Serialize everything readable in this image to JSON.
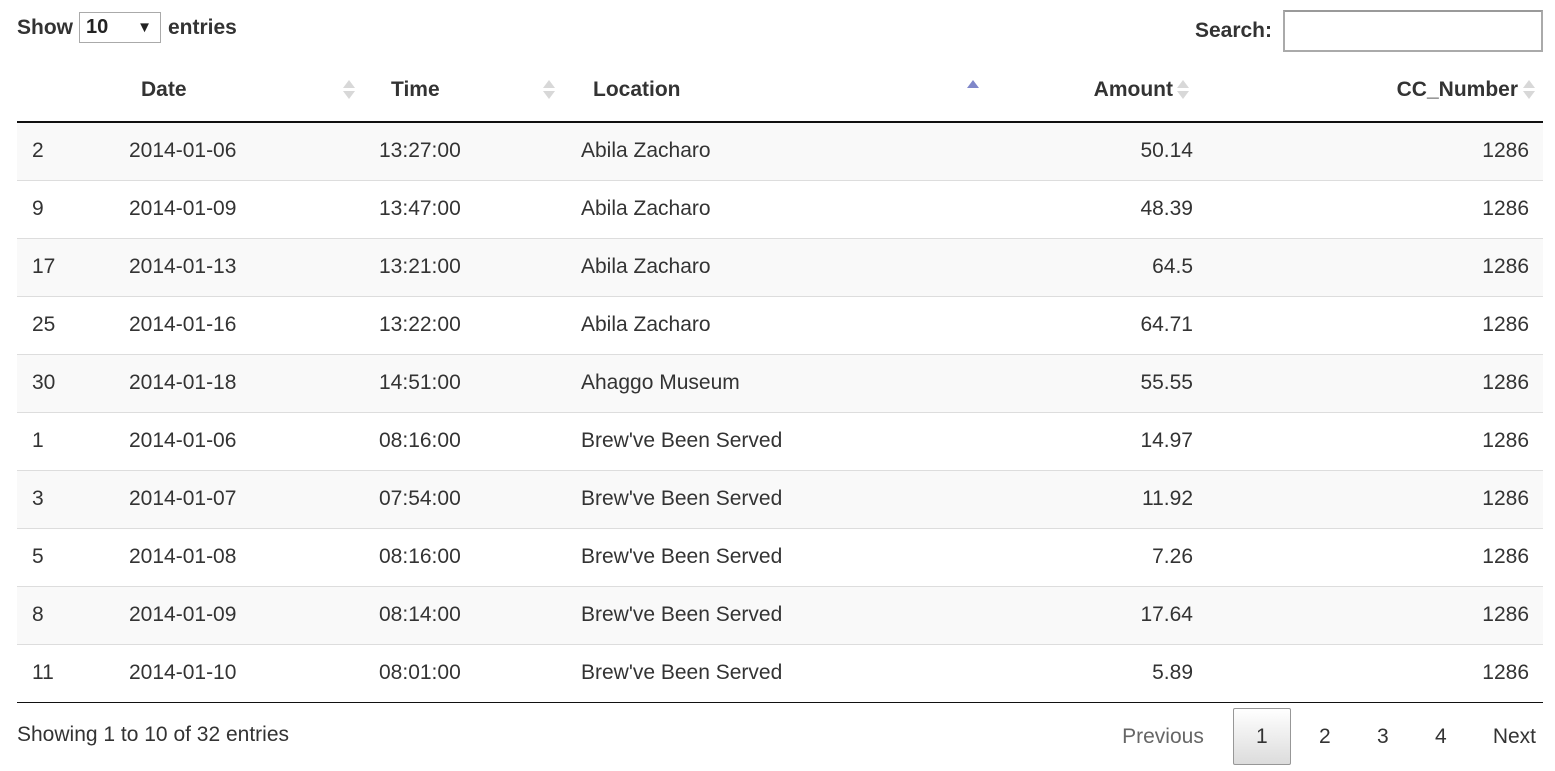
{
  "length_control": {
    "show_label": "Show",
    "selected": "10",
    "entries_label": "entries",
    "caret": "▼"
  },
  "search": {
    "label": "Search:",
    "value": "",
    "placeholder": ""
  },
  "table": {
    "columns": [
      {
        "key": "row",
        "label": ""
      },
      {
        "key": "date",
        "label": "Date"
      },
      {
        "key": "time",
        "label": "Time"
      },
      {
        "key": "location",
        "label": "Location"
      },
      {
        "key": "amount",
        "label": "Amount"
      },
      {
        "key": "cc_number",
        "label": "CC_Number"
      }
    ],
    "sorted_column": "location",
    "sort_direction": "ascending",
    "rows": [
      {
        "row": "2",
        "date": "2014-01-06",
        "time": "13:27:00",
        "location": "Abila Zacharo",
        "amount": "50.14",
        "cc_number": "1286"
      },
      {
        "row": "9",
        "date": "2014-01-09",
        "time": "13:47:00",
        "location": "Abila Zacharo",
        "amount": "48.39",
        "cc_number": "1286"
      },
      {
        "row": "17",
        "date": "2014-01-13",
        "time": "13:21:00",
        "location": "Abila Zacharo",
        "amount": "64.5",
        "cc_number": "1286"
      },
      {
        "row": "25",
        "date": "2014-01-16",
        "time": "13:22:00",
        "location": "Abila Zacharo",
        "amount": "64.71",
        "cc_number": "1286"
      },
      {
        "row": "30",
        "date": "2014-01-18",
        "time": "14:51:00",
        "location": "Ahaggo Museum",
        "amount": "55.55",
        "cc_number": "1286"
      },
      {
        "row": "1",
        "date": "2014-01-06",
        "time": "08:16:00",
        "location": "Brew've Been Served",
        "amount": "14.97",
        "cc_number": "1286"
      },
      {
        "row": "3",
        "date": "2014-01-07",
        "time": "07:54:00",
        "location": "Brew've Been Served",
        "amount": "11.92",
        "cc_number": "1286"
      },
      {
        "row": "5",
        "date": "2014-01-08",
        "time": "08:16:00",
        "location": "Brew've Been Served",
        "amount": "7.26",
        "cc_number": "1286"
      },
      {
        "row": "8",
        "date": "2014-01-09",
        "time": "08:14:00",
        "location": "Brew've Been Served",
        "amount": "17.64",
        "cc_number": "1286"
      },
      {
        "row": "11",
        "date": "2014-01-10",
        "time": "08:01:00",
        "location": "Brew've Been Served",
        "amount": "5.89",
        "cc_number": "1286"
      }
    ]
  },
  "info": {
    "text": "Showing 1 to 10 of 32 entries"
  },
  "pagination": {
    "previous_label": "Previous",
    "pages": [
      "1",
      "2",
      "3",
      "4"
    ],
    "current_page": "1",
    "next_label": "Next"
  },
  "colors": {
    "sort_active": "#7f87c9",
    "sort_inactive": "#d8d8d8",
    "stripe": "#f9f9f9",
    "header_rule": "#111111",
    "row_rule": "#dddddd"
  }
}
